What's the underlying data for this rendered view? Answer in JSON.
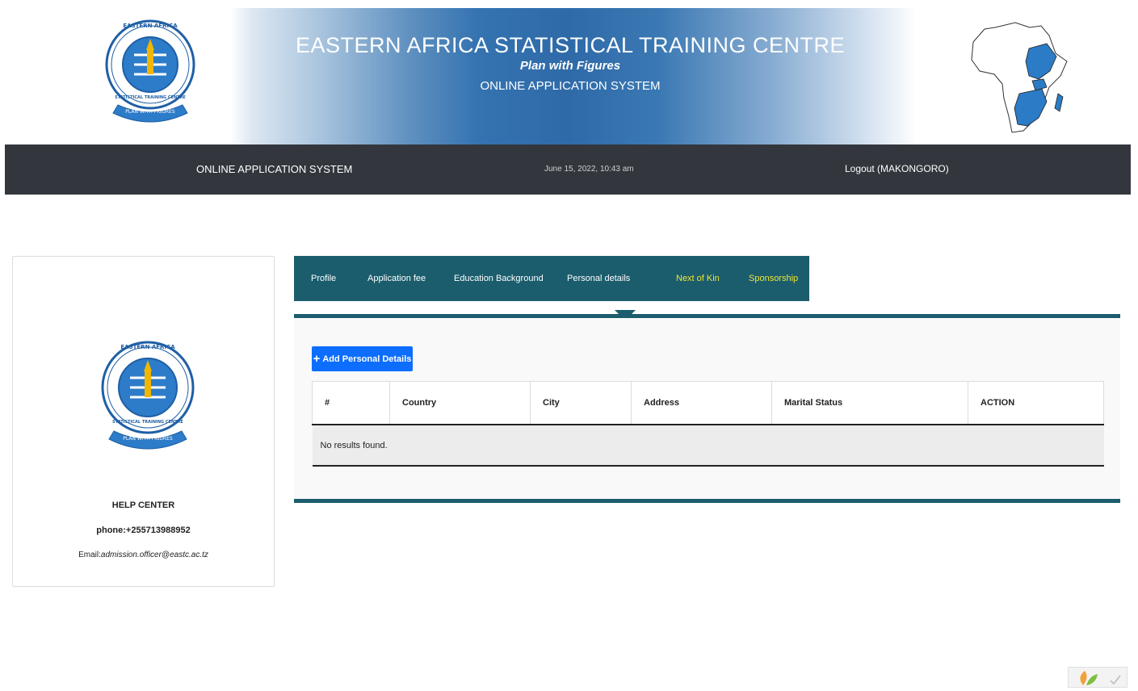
{
  "banner": {
    "title": "EASTERN AFRICA STATISTICAL TRAINING CENTRE",
    "motto": "Plan with Figures",
    "subtitle": "ONLINE APPLICATION SYSTEM",
    "logo_icon": "eastc-emblem-icon",
    "map_icon": "africa-map-icon",
    "logo_ring_top": "EASTERN AFRICA",
    "logo_ring_side": "STATISTICAL TRAINING CENTRE",
    "logo_ribbon": "PLAN WITH FIGURES"
  },
  "navbar": {
    "brand": "ONLINE APPLICATION SYSTEM",
    "datetime": "June 15, 2022, 10:43 am",
    "logout": "Logout (MAKONGORO)"
  },
  "sidebar": {
    "help_title": "HELP CENTER",
    "phone": "phone:+255713988952",
    "email_label": "Email:",
    "email": "admission.officer@eastc.ac.tz"
  },
  "tabs": [
    {
      "label": "Profile",
      "color": "#ffffff"
    },
    {
      "label": "Application fee",
      "color": "#ffffff"
    },
    {
      "label": "Education Background",
      "color": "#ffffff"
    },
    {
      "label": "Personal details",
      "color": "#ffffff"
    },
    {
      "label": "Next of Kin",
      "color": "#f0e535"
    },
    {
      "label": "Sponsorship",
      "color": "#f0e535"
    }
  ],
  "content": {
    "add_button": "Add Personal Details",
    "add_icon": "plus-icon",
    "table": {
      "headers": [
        "#",
        "Country",
        "City",
        "Address",
        "Marital Status",
        "ACTION"
      ],
      "empty_message": "No results found."
    }
  },
  "colors": {
    "accent": "#1b5d6d",
    "navbar": "#33373d",
    "button": "#0d6efd",
    "banner_blue": "#2f6aa8"
  }
}
